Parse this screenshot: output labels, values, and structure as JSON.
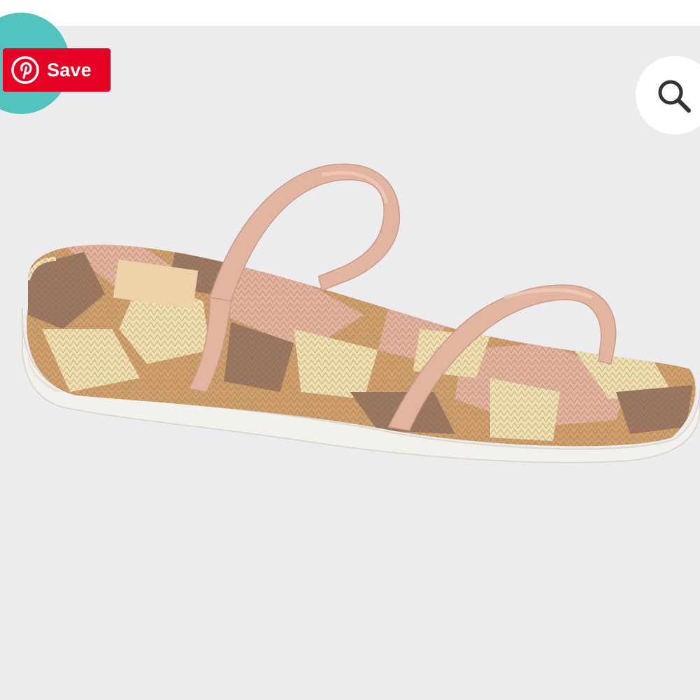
{
  "pin_button": {
    "label": "Save",
    "icon": "pinterest-logo-icon",
    "color": "#e60023"
  },
  "search_button": {
    "icon": "search-icon"
  },
  "product_image": {
    "subject": "sandal",
    "colors": {
      "background": "#ececee",
      "strap": "#e2b5a0",
      "sole": "#f4f2ed",
      "snake_pink": "#e4b3a0",
      "snake_tan": "#cf9f6c",
      "snake_brown": "#9c7862",
      "snake_cream": "#efdfb1"
    }
  },
  "accent": {
    "teal": "#53c4bd"
  }
}
